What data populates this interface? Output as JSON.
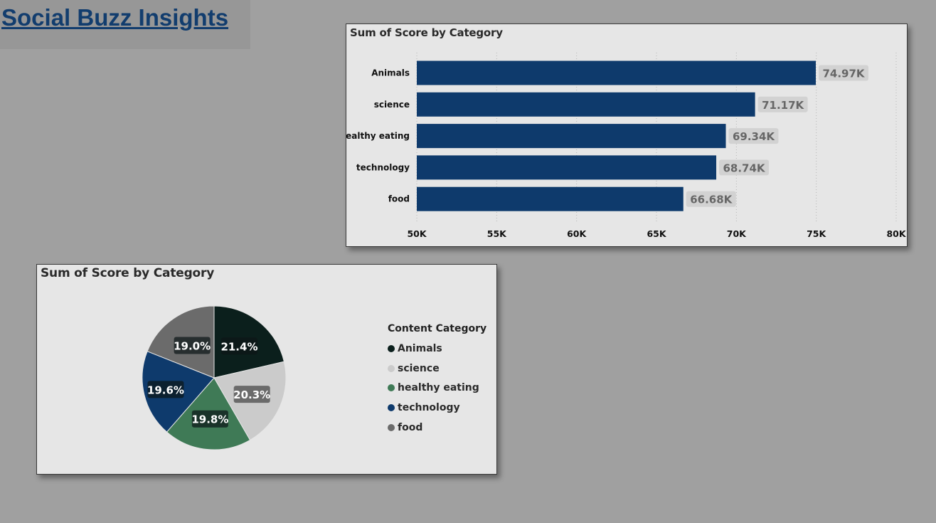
{
  "page": {
    "title": "Social Buzz Insights"
  },
  "colors": {
    "bar": "#0e3a6c",
    "label_bg": "#d2d2d2",
    "label_text": "#666666",
    "pie": [
      "#0b1f1c",
      "#cbcbcb",
      "#3f7a56",
      "#0e3a6c",
      "#6b6b6b"
    ]
  },
  "chart_data": [
    {
      "type": "bar",
      "orientation": "horizontal",
      "title": "Sum of Score by Category",
      "categories": [
        "Animals",
        "science",
        "healthy eating",
        "technology",
        "food"
      ],
      "values": [
        74970,
        71170,
        69340,
        68740,
        66680
      ],
      "data_labels": [
        "74.97K",
        "71.17K",
        "69.34K",
        "68.74K",
        "66.68K"
      ],
      "xlim": [
        50000,
        80000
      ],
      "x_ticks": [
        50000,
        55000,
        60000,
        65000,
        70000,
        75000,
        80000
      ],
      "x_tick_labels": [
        "50K",
        "55K",
        "60K",
        "65K",
        "70K",
        "75K",
        "80K"
      ],
      "grid": true
    },
    {
      "type": "pie",
      "title": "Sum of Score by Category",
      "legend_title": "Content Category",
      "legend_position": "right",
      "categories": [
        "Animals",
        "science",
        "healthy eating",
        "technology",
        "food"
      ],
      "values": [
        21.4,
        20.3,
        19.8,
        19.6,
        19.0
      ],
      "data_labels": [
        "21.4%",
        "20.3%",
        "19.8%",
        "19.6%",
        "19.0%"
      ]
    }
  ]
}
